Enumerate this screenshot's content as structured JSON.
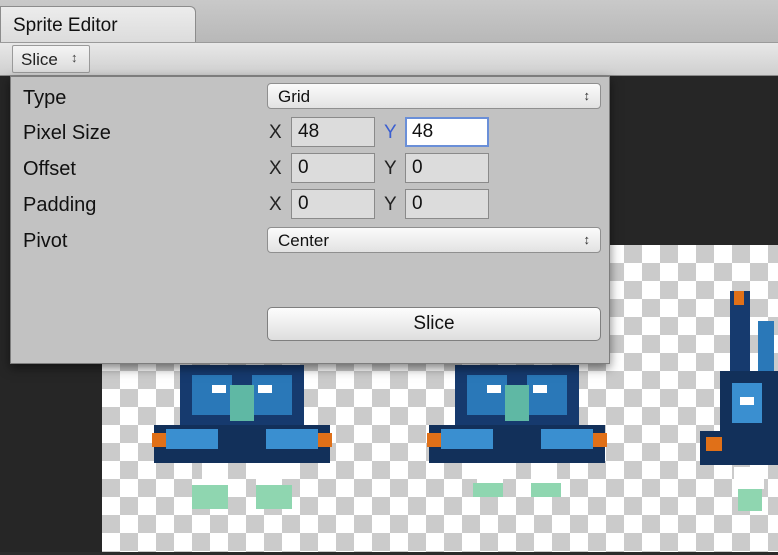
{
  "window": {
    "tab_title": "Sprite Editor"
  },
  "toolbar": {
    "slice_menu_label": "Slice",
    "slice_menu_arrow": "↕"
  },
  "slice_panel": {
    "type": {
      "label": "Type",
      "value": "Grid"
    },
    "pixel_size": {
      "label": "Pixel Size",
      "x_label": "X",
      "x_value": "48",
      "y_label": "Y",
      "y_value": "48"
    },
    "offset": {
      "label": "Offset",
      "x_label": "X",
      "x_value": "0",
      "y_label": "Y",
      "y_value": "0"
    },
    "padding": {
      "label": "Padding",
      "x_label": "X",
      "x_value": "0",
      "y_label": "Y",
      "y_value": "0"
    },
    "pivot": {
      "label": "Pivot",
      "value": "Center"
    },
    "slice_button_label": "Slice",
    "dropdown_arrow": "↕"
  },
  "colors": {
    "active_axis": "#3b5fd0",
    "focus_border": "#6a8fd8",
    "panel_bg": "#c2c2c2"
  },
  "icons": {
    "dropdown": "up-down-arrow-icon"
  }
}
